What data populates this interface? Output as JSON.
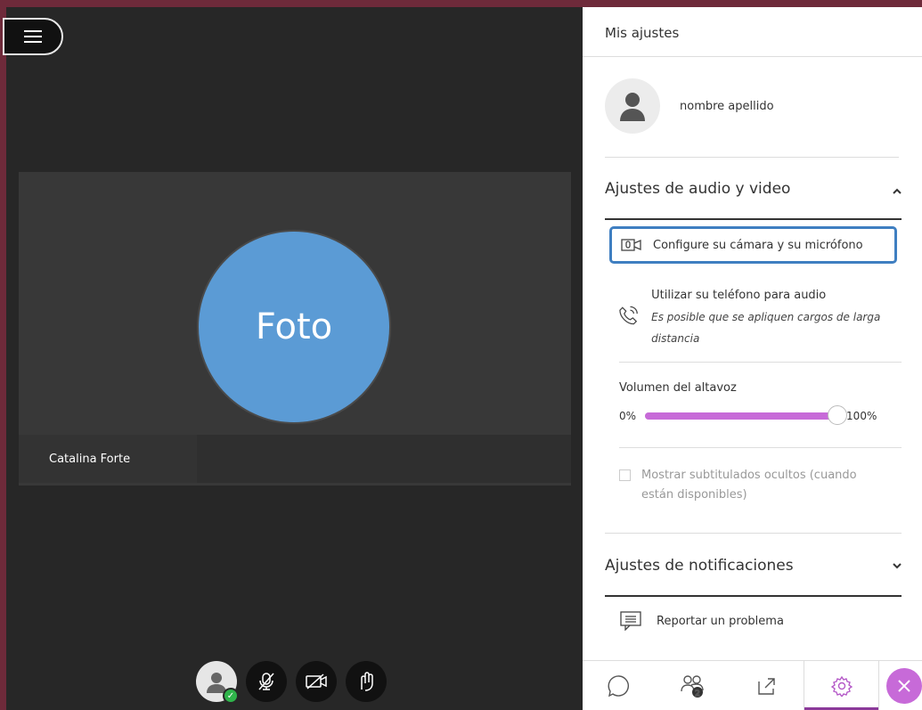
{
  "stage": {
    "photo_label": "Foto",
    "participant_name": "Catalina Forte"
  },
  "panel": {
    "title": "Mis ajustes",
    "profile_name": "nombre apellido",
    "audio_video": {
      "title": "Ajustes de audio y video",
      "configure": "Configure su cámara y su micrófono",
      "phone_title": "Utilizar su teléfono para audio",
      "phone_note": "Es posible que se apliquen cargos de larga distancia"
    },
    "volume": {
      "label": "Volumen del altavoz",
      "min": "0%",
      "max": "100%",
      "value": 1.0
    },
    "captions": "Mostrar subtitulados ocultos (cuando están disponibles)",
    "notifications_title": "Ajustes de notificaciones",
    "report": "Reportar un problema",
    "participants_badge": "2"
  },
  "colors": {
    "accent": "#c76ad8",
    "highlight": "#3f7fc1",
    "photo": "#5b9bd5",
    "frame": "#6e2a3a"
  }
}
